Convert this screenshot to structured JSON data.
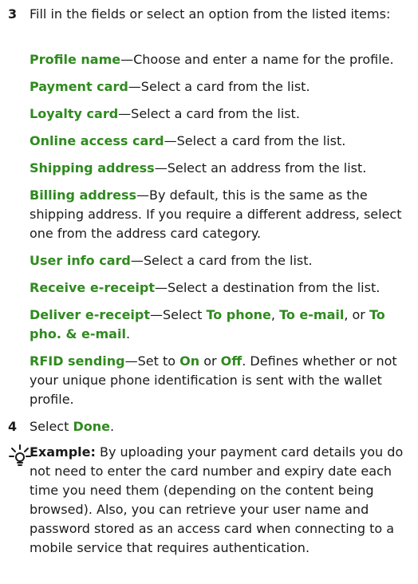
{
  "step3": {
    "number": "3",
    "text": "Fill in the fields or select an option from the listed items:"
  },
  "fields": [
    {
      "term": "Profile name",
      "dash": "—",
      "desc": "Choose and enter a name for the profile."
    },
    {
      "term": "Payment card",
      "dash": "—",
      "desc": "Select a card from the list."
    },
    {
      "term": "Loyalty card",
      "dash": "—",
      "desc": "Select a card from the list."
    },
    {
      "term": "Online access card",
      "dash": "—",
      "desc": "Select a card from the list."
    },
    {
      "term": "Shipping address",
      "dash": "—",
      "desc": "Select an address from the list."
    },
    {
      "term": "Billing address",
      "dash": "—",
      "desc": "By default, this is the same as the shipping address. If you require a different address, select one from the address card category."
    },
    {
      "term": "User info card",
      "dash": "—",
      "desc": "Select a card from the list."
    },
    {
      "term": "Receive e-receipt",
      "dash": "—",
      "desc": "Select a destination from the list."
    }
  ],
  "deliver": {
    "term": "Deliver e-receipt",
    "dash": "—",
    "lead": "Select ",
    "opt1": "To phone",
    "sep1": ", ",
    "opt2": "To e-mail",
    "sep2": ", or ",
    "opt3": "To pho. & e-mail",
    "end": "."
  },
  "rfid": {
    "term": "RFID sending",
    "dash": "—",
    "lead": "Set to ",
    "on": "On",
    "or": " or ",
    "off": "Off",
    "rest": ". Defines whether or not your unique phone identification is sent with the wallet profile."
  },
  "step4": {
    "number": "4",
    "lead": "Select ",
    "action": "Done",
    "end": "."
  },
  "tip": {
    "icon": "lightbulb-icon",
    "label": "Example:",
    "text": " By uploading your payment card details you do not need to enter the card number and expiry date each time you need them (depending on the content being browsed). Also, you can retrieve your user name and password stored as an access card when connecting to a mobile service that requires authentication."
  },
  "colors": {
    "accent": "#2f8a1f",
    "text": "#1a1a1a"
  }
}
